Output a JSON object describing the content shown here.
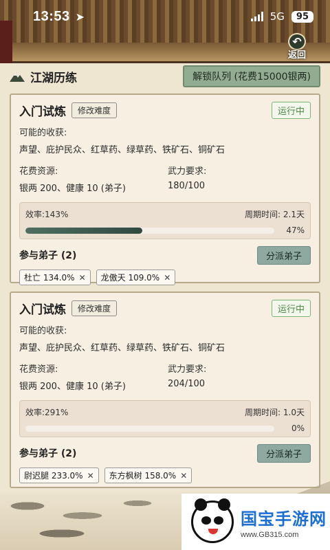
{
  "status_bar": {
    "time": "13:53",
    "network": "5G",
    "battery": "95"
  },
  "back_button": {
    "label": "返回"
  },
  "header": {
    "title": "江湖历练",
    "unlock_button": "解锁队列 (花费15000银两)"
  },
  "cards": [
    {
      "title": "入门试炼",
      "edit_button": "修改难度",
      "status": "运行中",
      "rewards_label": "可能的收获:",
      "rewards": "声望、庇护民众、红草药、绿草药、铁矿石、铜矿石",
      "cost_label": "花费资源:",
      "cost_value": "银两 200、健康 10 (弟子)",
      "power_label": "武力要求:",
      "power_value": "180/100",
      "efficiency": "效率:143%",
      "cycle": "周期时间: 2.1天",
      "progress": 47,
      "progress_label": "47%",
      "disciples_title": "参与弟子 (2)",
      "assign_button": "分派弟子",
      "disciples": [
        {
          "label": "杜亡 134.0%"
        },
        {
          "label": "龙傲天 109.0%"
        }
      ]
    },
    {
      "title": "入门试炼",
      "edit_button": "修改难度",
      "status": "运行中",
      "rewards_label": "可能的收获:",
      "rewards": "声望、庇护民众、红草药、绿草药、铁矿石、铜矿石",
      "cost_label": "花费资源:",
      "cost_value": "银两 200、健康 10 (弟子)",
      "power_label": "武力要求:",
      "power_value": "204/100",
      "efficiency": "效率:291%",
      "cycle": "周期时间: 1.0天",
      "progress": 0,
      "progress_label": "0%",
      "disciples_title": "参与弟子 (2)",
      "assign_button": "分派弟子",
      "disciples": [
        {
          "label": "尉迟腿 233.0%"
        },
        {
          "label": "东方枫树 158.0%"
        }
      ]
    }
  ],
  "watermark": {
    "brand": "国宝手游网",
    "url": "www.GB315.com"
  }
}
